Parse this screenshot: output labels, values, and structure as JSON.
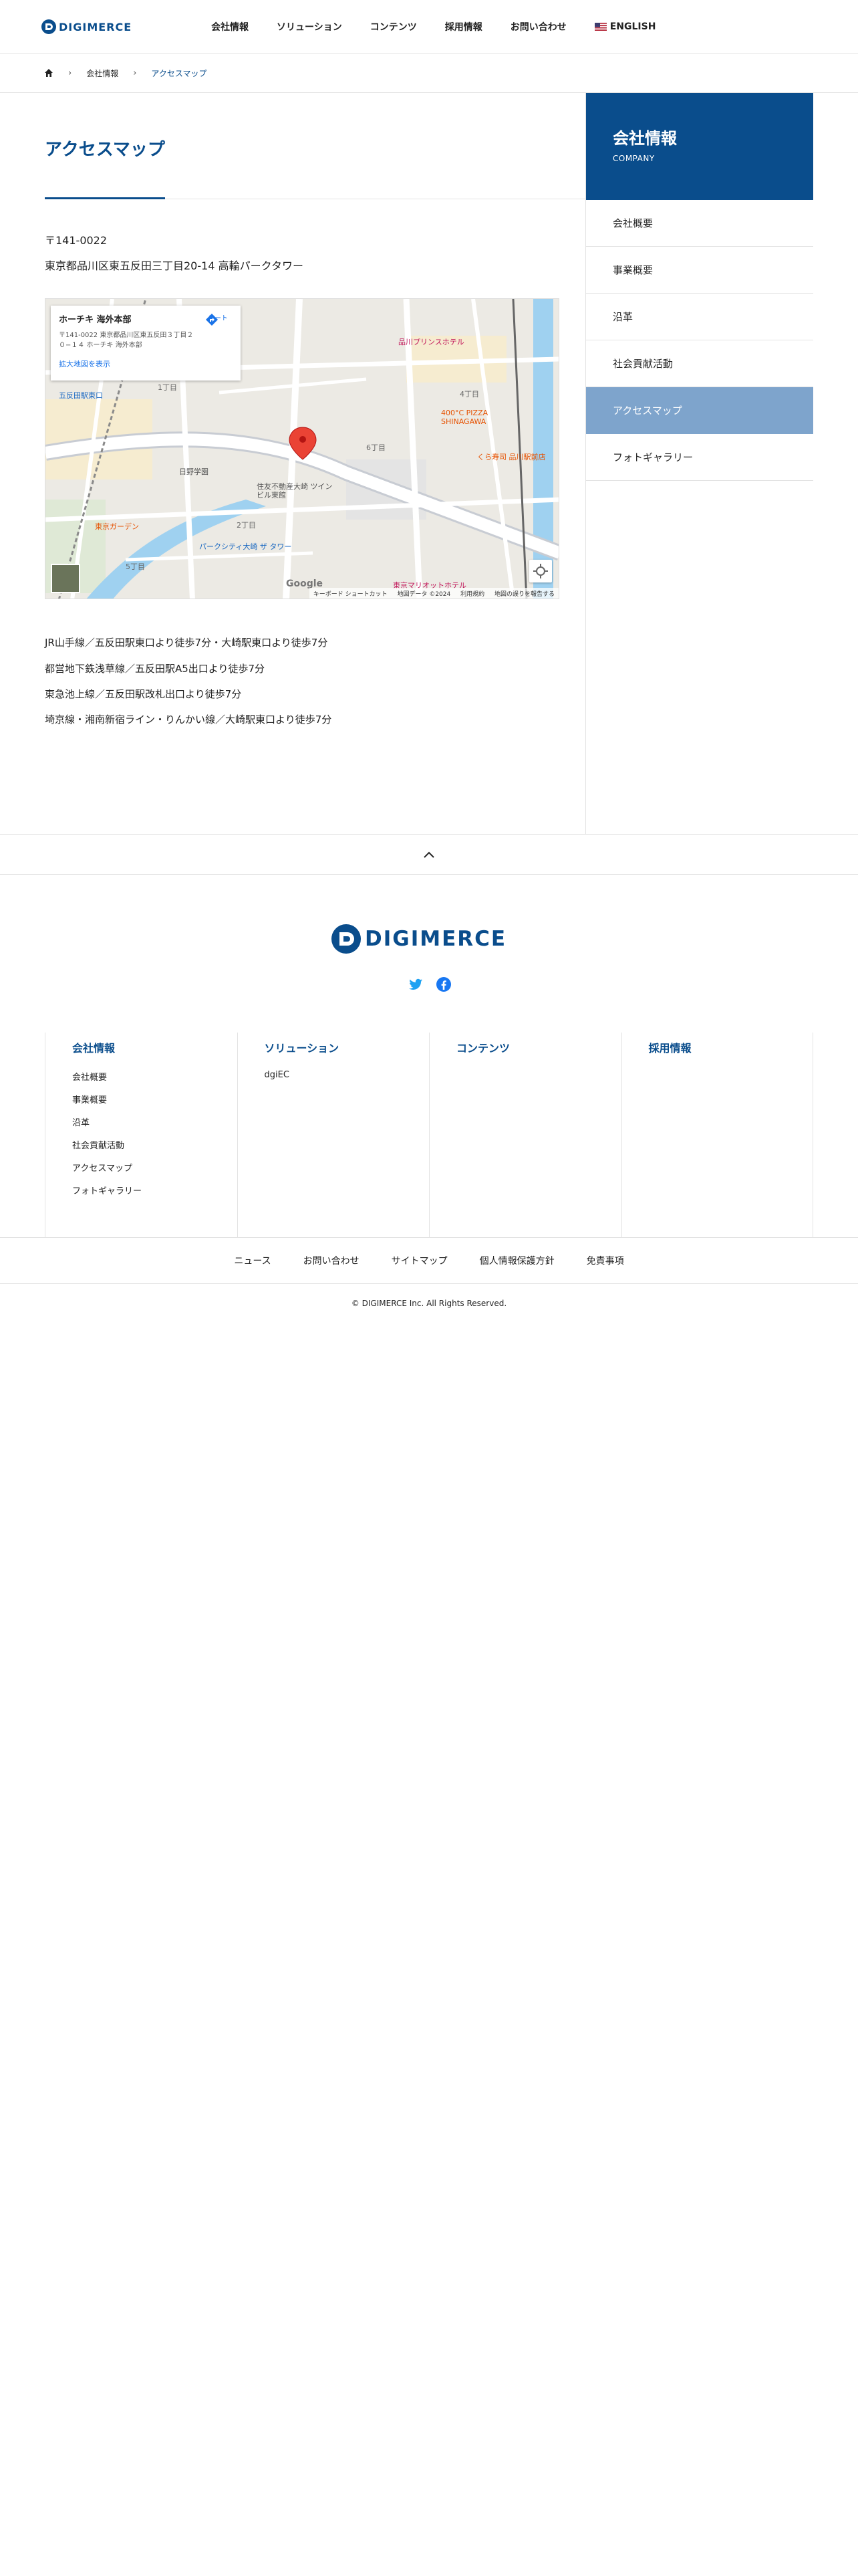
{
  "header": {
    "logo_text": "DIGIMERCE",
    "nav": [
      {
        "label": "会社情報"
      },
      {
        "label": "ソリューション"
      },
      {
        "label": "コンテンツ"
      },
      {
        "label": "採用情報"
      },
      {
        "label": "お問い合わせ"
      }
    ],
    "lang_label": "ENGLISH"
  },
  "breadcrumb": {
    "items": [
      "会社情報",
      "アクセスマップ"
    ]
  },
  "main": {
    "title": "アクセスマップ",
    "postal": "〒141-0022",
    "address": "東京都品川区東五反田三丁目20-14 高輪パークタワー",
    "map": {
      "card_title": "ホーチキ 海外本部",
      "card_address": "〒141-0022 東京都品川区東五反田３丁目２０−１４ ホーチキ 海外本部",
      "card_link": "拡大地図を表示",
      "route_label": "ルート",
      "google_logo": "Google",
      "footer": [
        "キーボード ショートカット",
        "地図データ ©2024",
        "利用規約",
        "地図の誤りを報告する"
      ],
      "labels": [
        "品川プリンスホテル",
        "400°C PIZZA SHINAGAWA",
        "くら寿司 品川駅前店",
        "住友不動産大崎 ツインビル東館",
        "パークシティ大崎 ザ タワー",
        "東京マリオットホテル",
        "五反田駅東口",
        "日野学園",
        "東京ガーデン",
        "4丁目",
        "6丁目",
        "2丁目",
        "5丁目",
        "1丁目"
      ]
    },
    "access": [
      "JR山手線／五反田駅東口より徒歩7分・大崎駅東口より徒歩7分",
      "都営地下鉄浅草線／五反田駅A5出口より徒歩7分",
      "東急池上線／五反田駅改札出口より徒歩7分",
      "埼京線・湘南新宿ライン・りんかい線／大崎駅東口より徒歩7分"
    ]
  },
  "sidebar": {
    "title": "会社情報",
    "subtitle": "COMPANY",
    "items": [
      {
        "label": "会社概要"
      },
      {
        "label": "事業概要"
      },
      {
        "label": "沿革"
      },
      {
        "label": "社会貢献活動"
      },
      {
        "label": "アクセスマップ"
      },
      {
        "label": "フォトギャラリー"
      }
    ],
    "active_index": 4
  },
  "footer": {
    "logo_text": "DIGIMERCE",
    "columns": [
      {
        "title": "会社情報",
        "items": [
          "会社概要",
          "事業概要",
          "沿革",
          "社会貢献活動",
          "アクセスマップ",
          "フォトギャラリー"
        ]
      },
      {
        "title": "ソリューション",
        "items": [
          "dgiEC"
        ]
      },
      {
        "title": "コンテンツ",
        "items": []
      },
      {
        "title": "採用情報",
        "items": []
      }
    ],
    "links": [
      "ニュース",
      "お問い合わせ",
      "サイトマップ",
      "個人情報保護方針",
      "免責事項"
    ],
    "copyright": "© DIGIMERCE Inc. All Rights Reserved."
  },
  "colors": {
    "brand": "#0a4d8c",
    "sidebar_active": "#7ea4cc",
    "twitter": "#1da1f2",
    "facebook": "#1877f2",
    "map_pin": "#ea4335"
  },
  "icons": [
    "home-icon",
    "chevron-right-icon",
    "us-flag-icon",
    "route-icon",
    "map-pin-icon",
    "locate-icon",
    "chevron-up-icon",
    "twitter-icon",
    "facebook-icon"
  ]
}
